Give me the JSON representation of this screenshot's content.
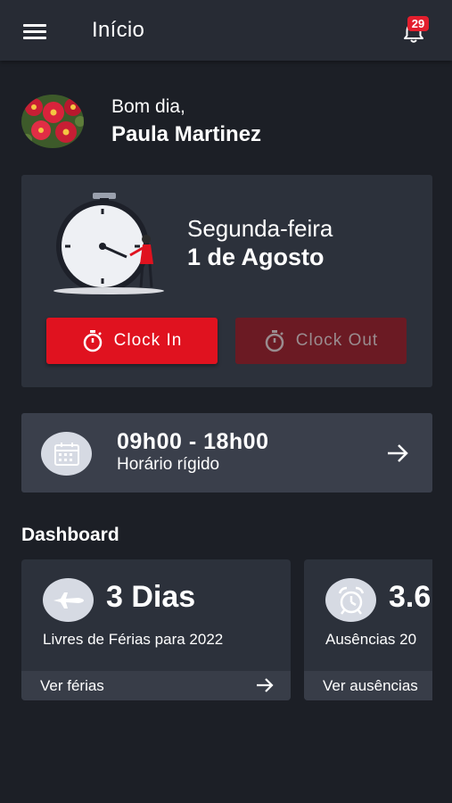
{
  "appbar": {
    "title": "Início",
    "menu_icon": "hamburger-menu-icon",
    "notification_icon": "bell-icon",
    "notification_count": "29"
  },
  "greeting": {
    "salutation": "Bom dia,",
    "name": "Paula Martinez",
    "avatar_icon": "red-flowers-avatar"
  },
  "clock_card": {
    "weekday": "Segunda-feira",
    "date": "1 de Agosto",
    "illustration": "stopwatch-illustration",
    "clock_in_label": "Clock In",
    "clock_out_label": "Clock Out",
    "clock_in_icon": "stopwatch-icon",
    "clock_out_icon": "stopwatch-icon",
    "clock_out_enabled": false
  },
  "schedule": {
    "time": "09h00 - 18h00",
    "type": "Horário rígido",
    "icon": "calendar-icon",
    "arrow_icon": "arrow-right-icon"
  },
  "dashboard": {
    "title": "Dashboard",
    "cards": [
      {
        "value": "3 Dias",
        "label": "Livres de Férias para 2022",
        "link": "Ver férias",
        "icon": "airplane-icon"
      },
      {
        "value": "3.6",
        "label": "Ausências 20",
        "link": "Ver ausências",
        "icon": "alarm-clock-icon"
      }
    ]
  },
  "colors": {
    "background": "#1c1f26",
    "appbar": "#272b34",
    "card": "#2c313b",
    "accent_red": "#e0121f",
    "disabled_red": "#6b1a23",
    "icon_circle": "#d6dae3"
  }
}
